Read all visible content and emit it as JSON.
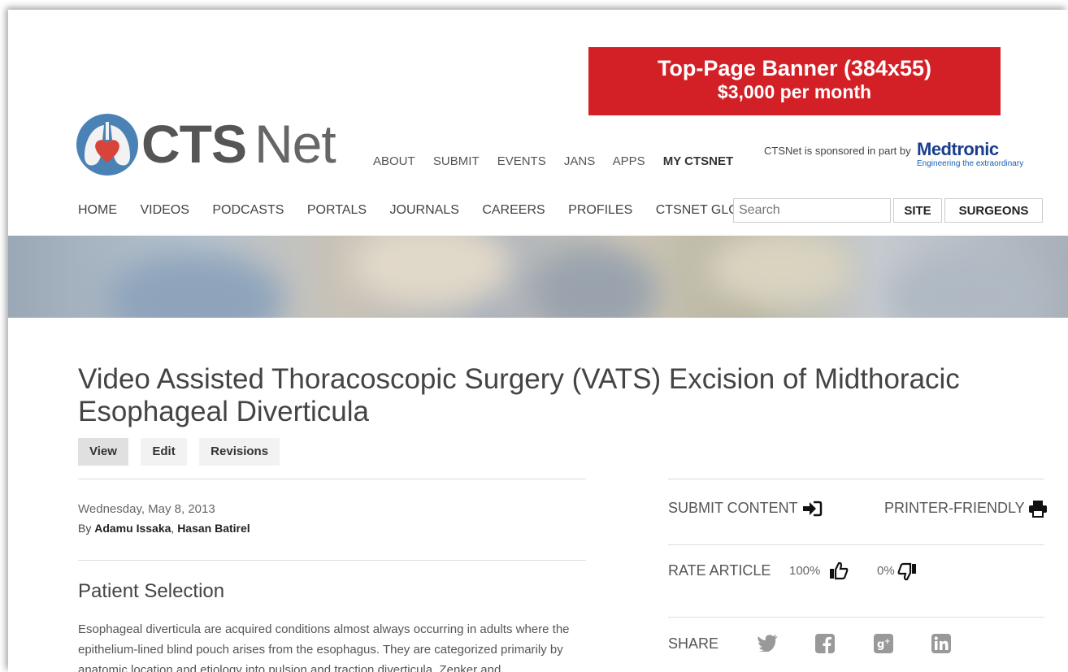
{
  "ad_banner": {
    "line1": "Top-Page Banner (384x55)",
    "line2": "$3,000 per month"
  },
  "logo": {
    "part1": "CTS",
    "part2": "Net"
  },
  "top_nav": [
    "ABOUT",
    "SUBMIT",
    "EVENTS",
    "JANS",
    "APPS",
    "MY CTSNET"
  ],
  "sponsor": {
    "text": "CTSNet is sponsored in part by",
    "brand": "Medtronic",
    "tagline": "Engineering the extraordinary"
  },
  "main_nav": [
    "HOME",
    "VIDEOS",
    "PODCASTS",
    "PORTALS",
    "JOURNALS",
    "CAREERS",
    "PROFILES",
    "CTSNET GLOBAL"
  ],
  "search": {
    "placeholder": "Search",
    "site_label": "SITE",
    "surgeons_label": "SURGEONS"
  },
  "article": {
    "title": "Video Assisted Thoracoscopic Surgery (VATS) Excision of Midthoracic Esophageal Diverticula",
    "tabs": [
      "View",
      "Edit",
      "Revisions"
    ],
    "date": "Wednesday, May 8, 2013",
    "by_label": "By",
    "authors": [
      "Adamu Issaka",
      "Hasan Batirel"
    ],
    "section_title": "Patient Selection",
    "body": "Esophageal diverticula are acquired conditions almost always occurring in adults where the epithelium-lined blind pouch arises from the esophagus. They are categorized primarily by anatomic location and etiology into pulsion and traction diverticula. Zenker and"
  },
  "sidebar": {
    "submit_content": "SUBMIT CONTENT",
    "printer_friendly": "PRINTER-FRIENDLY",
    "rate_label": "RATE ARTICLE",
    "rate_up": "100%",
    "rate_down": "0%",
    "share_label": "SHARE"
  },
  "colors": {
    "banner_red": "#d32027",
    "medtronic_blue": "#1a3e8c",
    "logo_blue": "#4a82b6",
    "heart_red": "#d8433a"
  }
}
